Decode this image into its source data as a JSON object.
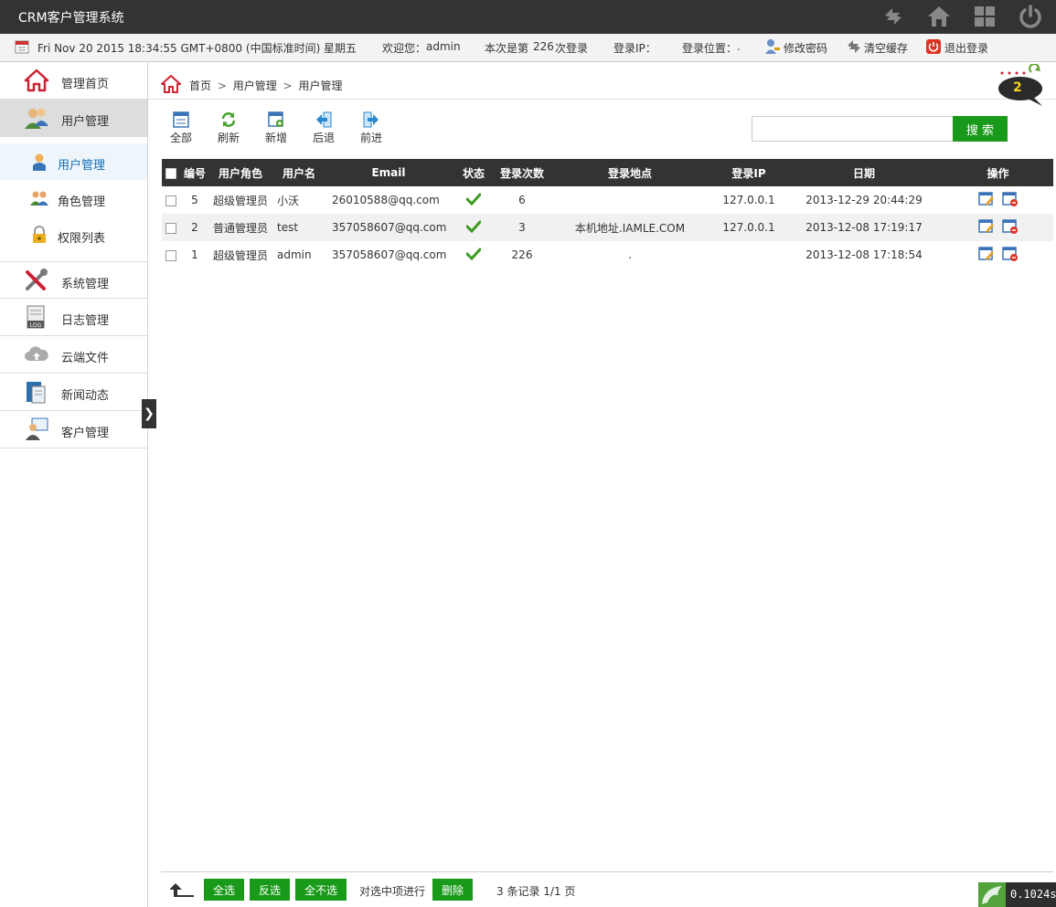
{
  "app": {
    "title": "CRM客户管理系统"
  },
  "topbar_icons": [
    "refresh-icon",
    "home-icon",
    "apps-grid-icon",
    "power-icon"
  ],
  "infobar": {
    "datetime": "Fri Nov 20 2015 18:34:55 GMT+0800 (中国标准时间) 星期五",
    "welcome_label": "欢迎您：",
    "user": "admin",
    "login_prefix": "本次是第",
    "login_count": "226",
    "login_suffix": "次登录",
    "ip_label": "登录IP：",
    "location_label": "登录位置：",
    "location_value": ".",
    "change_password": "修改密码",
    "clear_cache": "清空缓存",
    "logout": "退出登录"
  },
  "sidebar": {
    "menus": [
      {
        "label": "管理首页",
        "icon": "home-icon"
      },
      {
        "label": "用户管理",
        "icon": "users-icon"
      },
      {
        "label": "系统管理",
        "icon": "tools-icon"
      },
      {
        "label": "日志管理",
        "icon": "log-icon"
      },
      {
        "label": "云端文件",
        "icon": "cloud-icon"
      },
      {
        "label": "新闻动态",
        "icon": "news-icon"
      },
      {
        "label": "客户管理",
        "icon": "customer-icon"
      }
    ],
    "submenus": [
      {
        "label": "用户管理",
        "icon": "user-icon"
      },
      {
        "label": "角色管理",
        "icon": "roles-icon"
      },
      {
        "label": "权限列表",
        "icon": "lock-icon"
      }
    ],
    "toggle": "❯"
  },
  "breadcrumb": [
    "首页",
    "用户管理",
    "用户管理"
  ],
  "breadcrumb_sep": ">",
  "notification": {
    "count": "2"
  },
  "toolbar": [
    {
      "label": "全部",
      "icon": "list-icon"
    },
    {
      "label": "刷新",
      "icon": "refresh-icon"
    },
    {
      "label": "新增",
      "icon": "add-icon"
    },
    {
      "label": "后退",
      "icon": "back-icon"
    },
    {
      "label": "前进",
      "icon": "forward-icon"
    }
  ],
  "search": {
    "placeholder": "",
    "button": "搜 索"
  },
  "table": {
    "columns": [
      "编号",
      "用户角色",
      "用户名",
      "Email",
      "状态",
      "登录次数",
      "登录地点",
      "登录IP",
      "日期",
      "操作"
    ],
    "rows": [
      {
        "id": "5",
        "role": "超级管理员",
        "username": "小沃",
        "email": "26010588@qq.com",
        "status": "active",
        "logins": "6",
        "location": "",
        "ip": "127.0.0.1",
        "date": "2013-12-29 20:44:29"
      },
      {
        "id": "2",
        "role": "普通管理员",
        "username": "test",
        "email": "357058607@qq.com",
        "status": "active",
        "logins": "3",
        "location": "本机地址.IAMLE.COM",
        "ip": "127.0.0.1",
        "date": "2013-12-08 17:19:17"
      },
      {
        "id": "1",
        "role": "超级管理员",
        "username": "admin",
        "email": "357058607@qq.com",
        "status": "active",
        "logins": "226",
        "location": ".",
        "ip": "",
        "date": "2013-12-08 17:18:54"
      }
    ]
  },
  "footer": {
    "select_all": "全选",
    "invert": "反选",
    "select_none": "全不选",
    "batch_label": "对选中项进行",
    "delete": "删除",
    "summary": "3 条记录 1/1 页"
  },
  "perf": {
    "time": "0.1024s"
  },
  "colors": {
    "accent_green": "#1a9a1a",
    "topbar": "#333333",
    "active_blue": "#0d6fb8",
    "red": "#e00000"
  }
}
